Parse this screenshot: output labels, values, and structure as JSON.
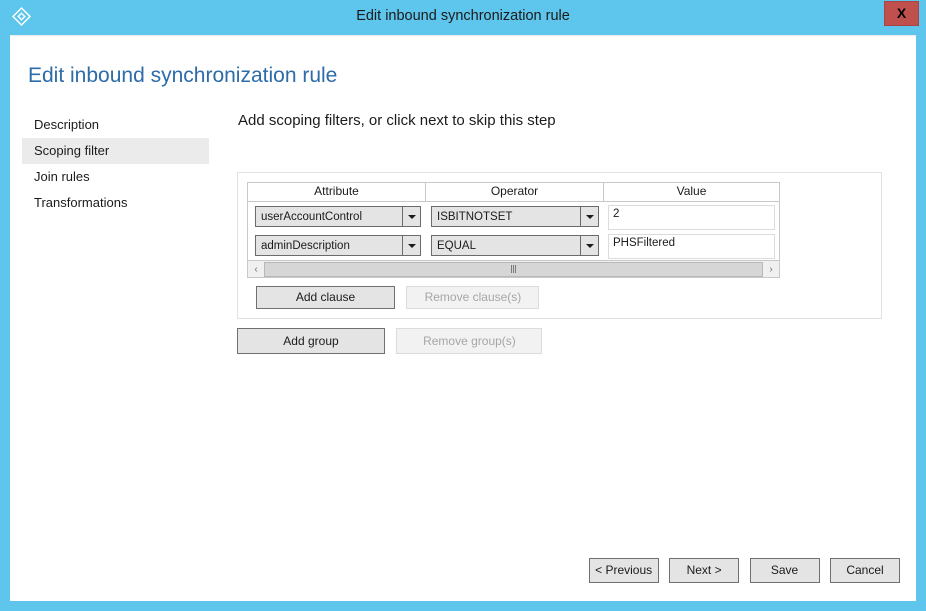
{
  "window": {
    "title": "Edit inbound synchronization rule",
    "icon": "diamond-icon",
    "close_label": "X",
    "frame_color": "#5ec5ec",
    "close_color": "#c0504d"
  },
  "page": {
    "title": "Edit inbound synchronization rule",
    "title_color": "#2d6ca8"
  },
  "sidebar": {
    "items": [
      {
        "label": "Description",
        "selected": false
      },
      {
        "label": "Scoping filter",
        "selected": true
      },
      {
        "label": "Join rules",
        "selected": false
      },
      {
        "label": "Transformations",
        "selected": false
      }
    ]
  },
  "main": {
    "step_heading": "Add scoping filters, or click next to skip this step",
    "table": {
      "columns": [
        "Attribute",
        "Operator",
        "Value"
      ],
      "rows": [
        {
          "attribute": "userAccountControl",
          "operator": "ISBITNOTSET",
          "value": "2"
        },
        {
          "attribute": "adminDescription",
          "operator": "EQUAL",
          "value": "PHSFiltered"
        }
      ]
    },
    "scrollbar": {
      "left_arrow": "‹",
      "right_arrow": "›"
    },
    "clause_buttons": {
      "add": "Add clause",
      "remove": "Remove clause(s)",
      "remove_disabled": true
    },
    "group_buttons": {
      "add": "Add group",
      "remove": "Remove group(s)",
      "remove_disabled": true
    }
  },
  "footer": {
    "previous": "< Previous",
    "next": "Next >",
    "save": "Save",
    "cancel": "Cancel"
  }
}
